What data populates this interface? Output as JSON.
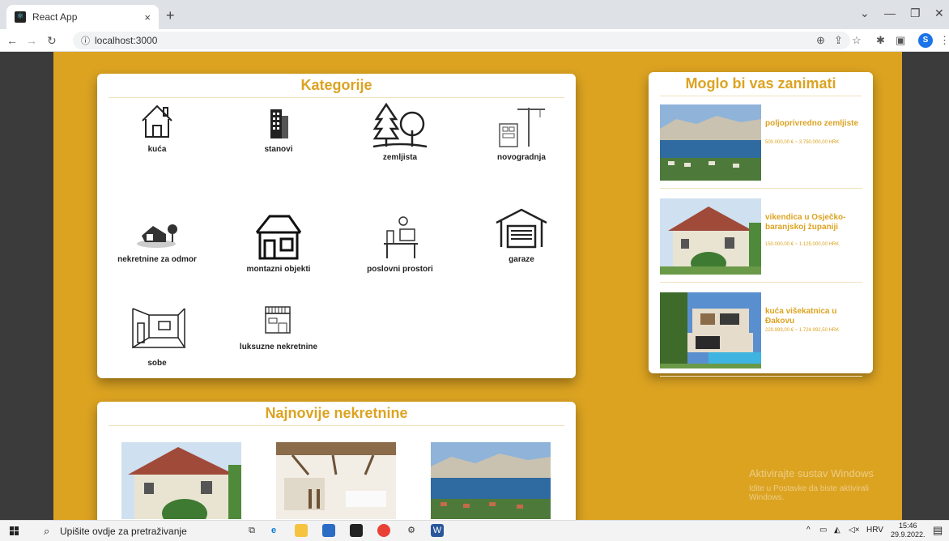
{
  "browser": {
    "tab_title": "React App",
    "tab_close": "×",
    "new_tab": "+",
    "minimize": "—",
    "restore": "❐",
    "close": "✕",
    "chevron": "⌄",
    "url": "localhost:3000",
    "profile_initial": "S"
  },
  "categories": {
    "title": "Kategorije",
    "items": [
      {
        "label": "kuća",
        "icon": "house-icon"
      },
      {
        "label": "stanovi",
        "icon": "building-icon"
      },
      {
        "label": "zemljista",
        "icon": "trees-icon"
      },
      {
        "label": "novogradnja",
        "icon": "construction-crane-icon"
      },
      {
        "label": "nekretnine za odmor",
        "icon": "holiday-house-icon"
      },
      {
        "label": "montazni objekti",
        "icon": "prefab-house-icon"
      },
      {
        "label": "poslovni prostori",
        "icon": "office-desk-icon"
      },
      {
        "label": "garaze",
        "icon": "garage-icon"
      },
      {
        "label": "sobe",
        "icon": "room-icon"
      },
      {
        "label": "luksuzne nekretnine",
        "icon": "luxury-building-icon"
      }
    ]
  },
  "suggestions": {
    "title": "Moglo bi vas zanimati",
    "items": [
      {
        "title": "poljoprivredno zemljiste",
        "price": "500.000,00 € ~ 3.750.000,00 HRK"
      },
      {
        "title": "vikendica u Osječko-baranjskoj županiji",
        "price": "150.000,00 € ~ 1.125.000,00 HRK"
      },
      {
        "title": "kuća višekatnica u Đakovu",
        "price": "229.999,00 € ~ 1.724.992,50 HRK"
      }
    ]
  },
  "newest": {
    "title": "Najnovije nekretnine"
  },
  "watermark": {
    "line1": "Aktivirajte sustav Windows",
    "line2": "Idite u Postavke da biste aktivirali Windows."
  },
  "taskbar": {
    "search_placeholder": "Upišite ovdje za pretraživanje",
    "language": "HRV",
    "time": "15:46",
    "date": "29.9.2022."
  }
}
